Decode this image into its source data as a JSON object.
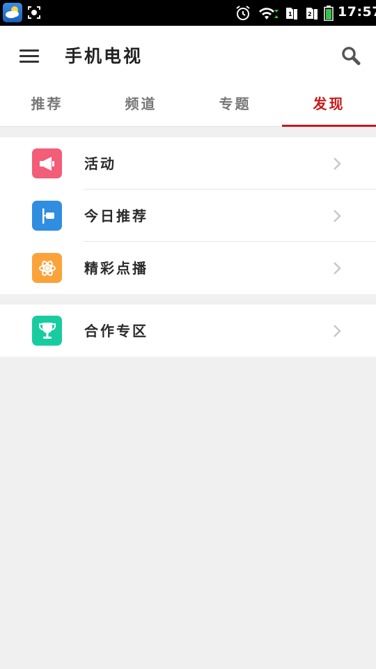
{
  "status_bar": {
    "time": "17:57",
    "icons": [
      "weather-icon",
      "screenshot-icon",
      "alarm-icon",
      "wifi-icon",
      "sim1-icon",
      "sim2-icon",
      "battery-icon"
    ]
  },
  "app_bar": {
    "title": "手机电视",
    "menu_icon": "menu-icon",
    "search_icon": "search-icon"
  },
  "tabs": [
    {
      "label": "推荐",
      "active": false
    },
    {
      "label": "频道",
      "active": false
    },
    {
      "label": "专题",
      "active": false
    },
    {
      "label": "发现",
      "active": true
    }
  ],
  "groups": [
    {
      "items": [
        {
          "label": "活动",
          "icon": "megaphone-icon",
          "color": "#f25d78"
        },
        {
          "label": "今日推荐",
          "icon": "recommend-icon",
          "color": "#2f8ee0"
        },
        {
          "label": "精彩点播",
          "icon": "atom-icon",
          "color": "#fba33a"
        }
      ]
    },
    {
      "items": [
        {
          "label": "合作专区",
          "icon": "trophy-icon",
          "color": "#18cca0"
        }
      ]
    }
  ],
  "colors": {
    "accent": "#c81a1a",
    "background": "#f0f0f0"
  }
}
